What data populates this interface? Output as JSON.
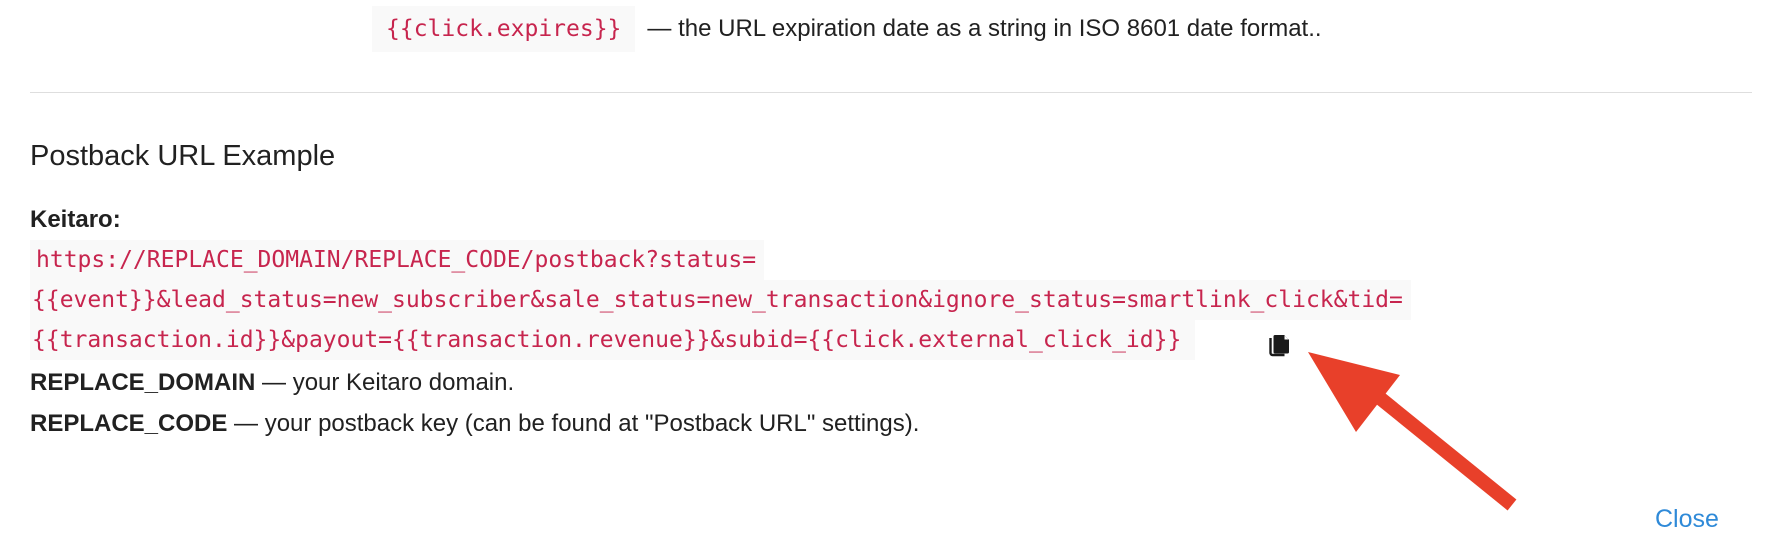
{
  "top": {
    "code": "{{click.expires}}",
    "description": "— the URL expiration date as a string in ISO 8601 date format.."
  },
  "section": {
    "title": "Postback URL Example",
    "tracker_label": "Keitaro:",
    "url_lines": [
      "https://REPLACE_DOMAIN/REPLACE_CODE/postback?status=",
      "{{event}}&lead_status=new_subscriber&sale_status=new_transaction&ignore_status=smartlink_click&tid=",
      "{{transaction.id}}&payout={{transaction.revenue}}&subid={{click.external_click_id}}"
    ],
    "copy_icon": "copy-icon"
  },
  "notes": [
    {
      "term": "REPLACE_DOMAIN",
      "text": " — your Keitaro domain."
    },
    {
      "term": "REPLACE_CODE",
      "text": " — your postback key (can be found at \"Postback URL\" settings)."
    }
  ],
  "annotation": {
    "arrow_color": "#e8402a"
  },
  "footer": {
    "close_label": "Close"
  },
  "colors": {
    "code_text": "#c7254e",
    "code_bg": "#f9f9f9",
    "link": "#2f8ad8"
  }
}
